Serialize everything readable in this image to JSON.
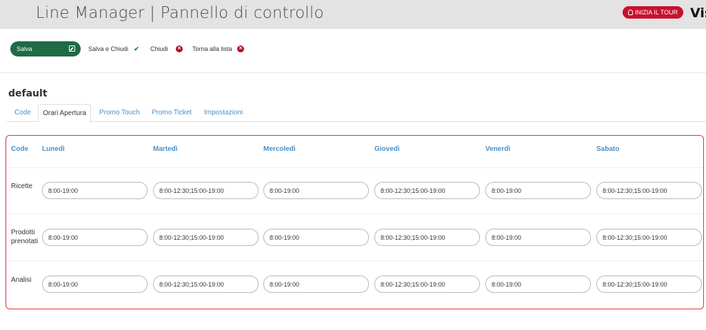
{
  "header": {
    "title": "Line Manager | Pannello di controllo",
    "tour_button": "INIZIA IL TOUR",
    "brand": "Vis"
  },
  "toolbar": {
    "save_label": "Salva",
    "save_close_label": "Salva e Chiudi",
    "close_label": "Chiudi",
    "back_label": "Torna alla lista"
  },
  "section_title": "default",
  "tabs": [
    {
      "label": "Code",
      "active": false
    },
    {
      "label": "Orari Apertura",
      "active": true
    },
    {
      "label": "Promo Touch",
      "active": false
    },
    {
      "label": "Promo Ticket",
      "active": false
    },
    {
      "label": "Impostazioni",
      "active": false
    }
  ],
  "table": {
    "headers": [
      "Code",
      "Lunedì",
      "Martedì",
      "Mercoledì",
      "Giovedì",
      "Venerdì",
      "Sabato"
    ],
    "rows": [
      {
        "label": "Ricette",
        "values": [
          "8:00-19:00",
          "8:00-12:30;15:00-19:00",
          "8:00-19:00",
          "8:00-12:30;15:00-19:00",
          "8:00-19:00",
          "8:00-12:30;15:00-19:00"
        ]
      },
      {
        "label": "Prodotti prenotati",
        "values": [
          "8:00-19:00",
          "8:00-12:30;15:00-19:00",
          "8:00-19:00",
          "8:00-12:30;15:00-19:00",
          "8:00-19:00",
          "8:00-12:30;15:00-19:00"
        ]
      },
      {
        "label": "Analisi",
        "values": [
          "8:00-19:00",
          "8:00-12:30;15:00-19:00",
          "8:00-19:00",
          "8:00-12:30;15:00-19:00",
          "8:00-19:00",
          "8:00-12:30;15:00-19:00"
        ]
      }
    ]
  },
  "colors": {
    "accent_green": "#1e6b44",
    "accent_red": "#c8102e",
    "link_blue": "#4a90c8",
    "panel_border": "#e0303a"
  },
  "icons": {
    "tour": "lightbulb-icon",
    "save": "edit-icon",
    "save_close": "check-icon",
    "close": "close-circle-icon",
    "back": "close-circle-icon"
  }
}
